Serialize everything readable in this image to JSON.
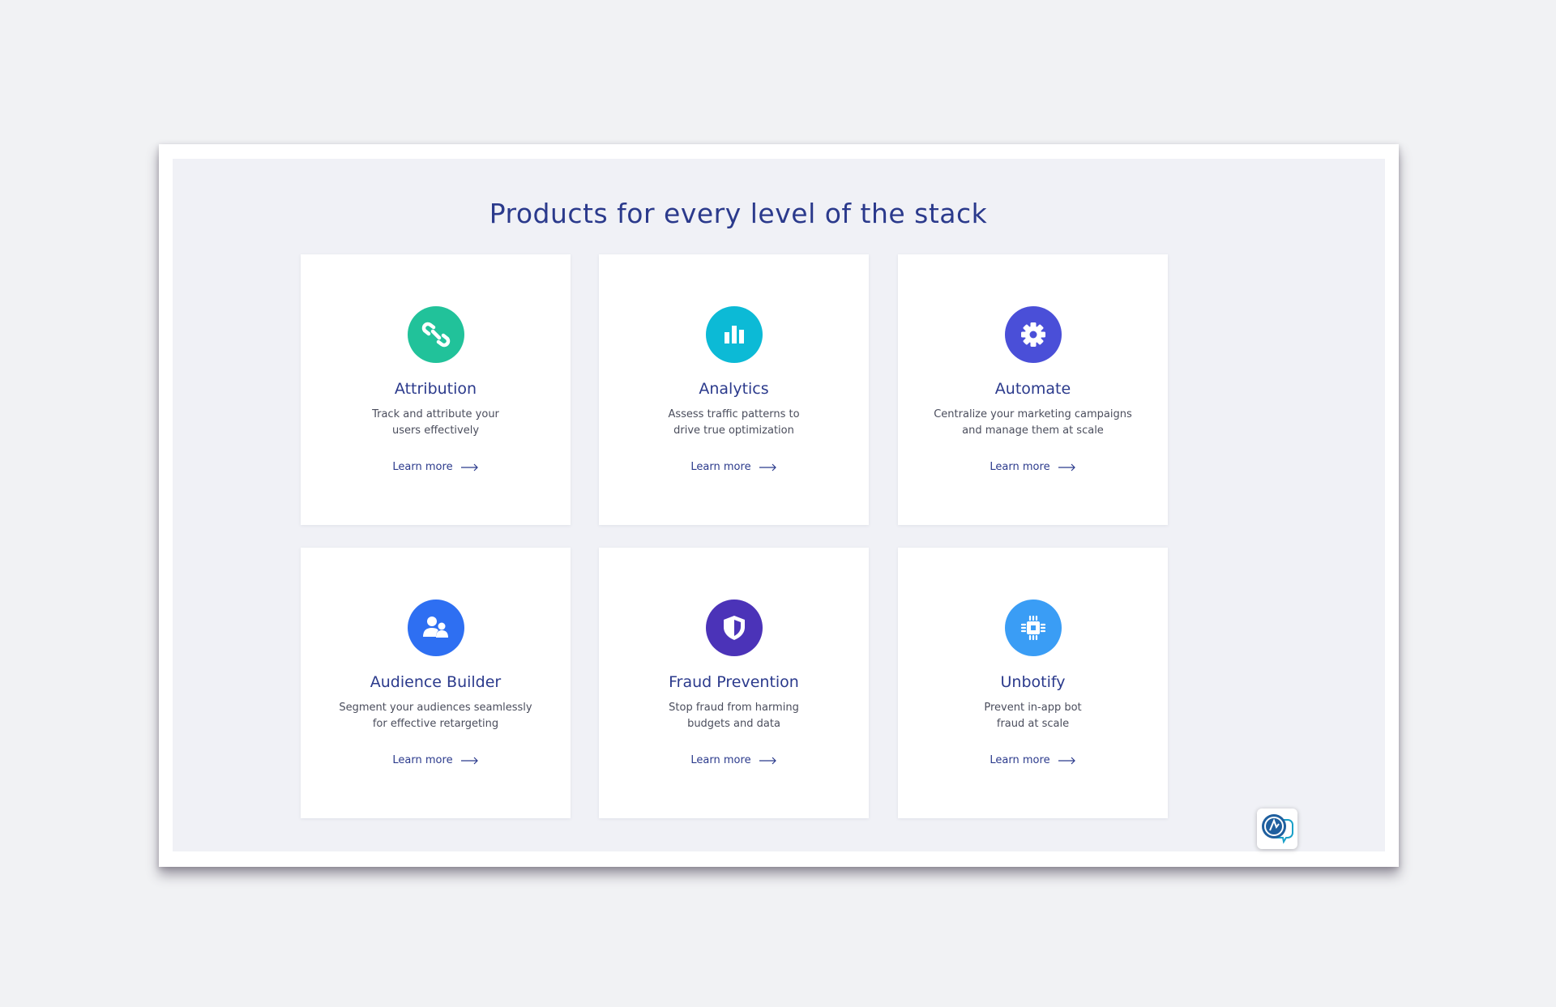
{
  "section": {
    "heading": "Products for every level of the stack"
  },
  "cards": [
    {
      "title": "Attribution",
      "description": "Track and attribute your\nusers effectively",
      "link": "Learn more",
      "icon": "link-icon",
      "color": "#21c29a"
    },
    {
      "title": "Analytics",
      "description": "Assess traffic patterns to\ndrive true optimization",
      "link": "Learn more",
      "icon": "bar-chart-icon",
      "color": "#0cbad6"
    },
    {
      "title": "Automate",
      "description": "Centralize your marketing campaigns\nand manage them at scale",
      "link": "Learn more",
      "icon": "gear-icon",
      "color": "#4a4fd8"
    },
    {
      "title": "Audience Builder",
      "description": "Segment your audiences seamlessly\nfor effective retargeting",
      "link": "Learn more",
      "icon": "users-icon",
      "color": "#2e6ff2"
    },
    {
      "title": "Fraud Prevention",
      "description": "Stop fraud from harming\nbudgets and data",
      "link": "Learn more",
      "icon": "shield-icon",
      "color": "#4b33b8"
    },
    {
      "title": "Unbotify",
      "description": "Prevent in-app bot\nfraud at scale",
      "link": "Learn more",
      "icon": "chip-icon",
      "color": "#3a9df5"
    }
  ],
  "widget": {
    "icon": "chat-bubble-icon"
  },
  "colors": {
    "heading": "#2b3a8c",
    "panel_bg": "#f0f1f6",
    "page_bg": "#f1f2f4"
  }
}
